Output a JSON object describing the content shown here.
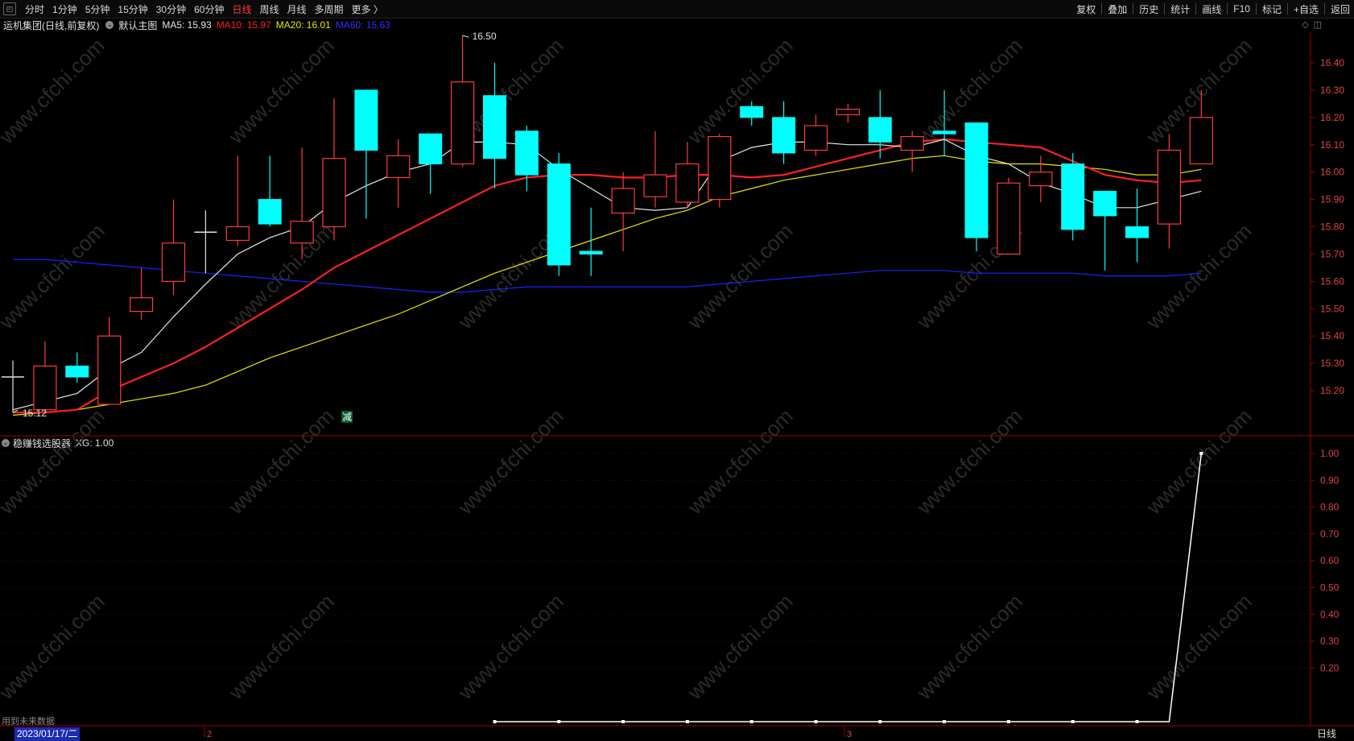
{
  "toolbar": {
    "periods": [
      "分时",
      "1分钟",
      "5分钟",
      "15分钟",
      "30分钟",
      "60分钟",
      "日线",
      "周线",
      "月线",
      "多周期",
      "更多 〉"
    ],
    "active_period": "日线",
    "right_items": [
      "复权",
      "叠加",
      "历史",
      "统计",
      "画线",
      "F10",
      "标记",
      "+自选",
      "返回"
    ]
  },
  "info": {
    "stock_name": "运机集团(日线,前复权)",
    "template": "默认主图",
    "ma5": "MA5: 15.93",
    "ma10": "MA10: 15.97",
    "ma20": "MA20: 16.01",
    "ma60": "MA60: 15.63"
  },
  "indicator": {
    "name": "稳赚钱选股器",
    "value_text": "XG: 1.00",
    "future_note": "用到未来数据"
  },
  "footer": {
    "date": "2023/01/17/二",
    "period": "日线",
    "month_labels": [
      "2",
      "3"
    ]
  },
  "colors": {
    "up": "#ff3b3b",
    "down": "#00ffff",
    "ma5": "#e6e6e6",
    "ma10": "#ff2020",
    "ma20": "#e8e800",
    "ma60": "#2020ff",
    "axis": "#a00000",
    "watermark": "#2a2a2a"
  },
  "watermark": "www.cfchi.com",
  "annotations": {
    "high": "16.50",
    "low": "15.12",
    "signal": "减"
  },
  "chart_data": [
    {
      "type": "candlestick",
      "title": "",
      "y_ticks": [
        "16.40",
        "16.30",
        "16.20",
        "16.10",
        "16.00",
        "15.90",
        "15.80",
        "15.70",
        "15.60",
        "15.50",
        "15.40",
        "15.30",
        "15.20"
      ],
      "ylim": [
        15.0,
        16.55
      ],
      "candles": [
        {
          "o": 15.25,
          "c": 15.25,
          "h": 15.31,
          "l": 15.12
        },
        {
          "o": 15.13,
          "c": 15.29,
          "h": 15.38,
          "l": 15.12
        },
        {
          "o": 15.29,
          "c": 15.25,
          "h": 15.34,
          "l": 15.23
        },
        {
          "o": 15.15,
          "c": 15.4,
          "h": 15.47,
          "l": 15.15
        },
        {
          "o": 15.49,
          "c": 15.54,
          "h": 15.65,
          "l": 15.46
        },
        {
          "o": 15.6,
          "c": 15.74,
          "h": 15.9,
          "l": 15.55
        },
        {
          "o": 15.78,
          "c": 15.78,
          "h": 15.86,
          "l": 15.63
        },
        {
          "o": 15.75,
          "c": 15.8,
          "h": 16.06,
          "l": 15.73
        },
        {
          "o": 15.9,
          "c": 15.81,
          "h": 16.06,
          "l": 15.8
        },
        {
          "o": 15.74,
          "c": 15.82,
          "h": 16.09,
          "l": 15.68
        },
        {
          "o": 15.8,
          "c": 16.05,
          "h": 16.27,
          "l": 15.75
        },
        {
          "o": 16.3,
          "c": 16.08,
          "h": 16.3,
          "l": 15.83
        },
        {
          "o": 15.98,
          "c": 16.06,
          "h": 16.12,
          "l": 15.87
        },
        {
          "o": 16.14,
          "c": 16.03,
          "h": 16.14,
          "l": 15.92
        },
        {
          "o": 16.03,
          "c": 16.33,
          "h": 16.5,
          "l": 16.02
        },
        {
          "o": 16.28,
          "c": 16.05,
          "h": 16.4,
          "l": 15.94
        },
        {
          "o": 16.15,
          "c": 15.99,
          "h": 16.17,
          "l": 15.93
        },
        {
          "o": 16.03,
          "c": 15.66,
          "h": 16.07,
          "l": 15.62
        },
        {
          "o": 15.71,
          "c": 15.7,
          "h": 15.87,
          "l": 15.62
        },
        {
          "o": 15.85,
          "c": 15.94,
          "h": 16.0,
          "l": 15.71
        },
        {
          "o": 15.91,
          "c": 15.99,
          "h": 16.15,
          "l": 15.87
        },
        {
          "o": 15.89,
          "c": 16.03,
          "h": 16.11,
          "l": 15.87
        },
        {
          "o": 15.9,
          "c": 16.13,
          "h": 16.14,
          "l": 15.87
        },
        {
          "o": 16.24,
          "c": 16.2,
          "h": 16.26,
          "l": 16.17
        },
        {
          "o": 16.2,
          "c": 16.07,
          "h": 16.26,
          "l": 16.03
        },
        {
          "o": 16.08,
          "c": 16.17,
          "h": 16.21,
          "l": 16.06
        },
        {
          "o": 16.21,
          "c": 16.23,
          "h": 16.25,
          "l": 16.18
        },
        {
          "o": 16.2,
          "c": 16.11,
          "h": 16.3,
          "l": 16.05
        },
        {
          "o": 16.08,
          "c": 16.13,
          "h": 16.15,
          "l": 16.0
        },
        {
          "o": 16.15,
          "c": 16.14,
          "h": 16.3,
          "l": 16.06
        },
        {
          "o": 16.18,
          "c": 15.76,
          "h": 16.18,
          "l": 15.71
        },
        {
          "o": 15.7,
          "c": 15.96,
          "h": 15.98,
          "l": 15.7
        },
        {
          "o": 15.95,
          "c": 16.0,
          "h": 16.06,
          "l": 15.89
        },
        {
          "o": 16.03,
          "c": 15.79,
          "h": 16.07,
          "l": 15.75
        },
        {
          "o": 15.93,
          "c": 15.84,
          "h": 15.93,
          "l": 15.64
        },
        {
          "o": 15.8,
          "c": 15.76,
          "h": 15.94,
          "l": 15.67
        },
        {
          "o": 15.81,
          "c": 16.08,
          "h": 16.14,
          "l": 15.72
        },
        {
          "o": 16.03,
          "c": 16.2,
          "h": 16.3,
          "l": 16.03
        }
      ],
      "ma5": [
        15.13,
        15.16,
        15.19,
        15.28,
        15.34,
        15.47,
        15.59,
        15.7,
        15.76,
        15.8,
        15.89,
        15.95,
        16.0,
        16.03,
        16.11,
        16.11,
        16.1,
        16.01,
        15.94,
        15.87,
        15.86,
        15.87,
        16.04,
        16.09,
        16.11,
        16.11,
        16.1,
        16.1,
        16.09,
        16.12,
        16.06,
        16.03,
        15.96,
        15.92,
        15.87,
        15.87,
        15.9,
        15.93
      ],
      "ma10": [
        15.12,
        15.12,
        15.13,
        15.2,
        15.25,
        15.3,
        15.36,
        15.43,
        15.5,
        15.57,
        15.65,
        15.71,
        15.77,
        15.83,
        15.89,
        15.95,
        15.98,
        15.99,
        15.99,
        15.98,
        15.98,
        15.99,
        15.99,
        15.98,
        15.99,
        16.02,
        16.05,
        16.08,
        16.11,
        16.12,
        16.11,
        16.1,
        16.09,
        16.04,
        15.99,
        15.97,
        15.96,
        15.97
      ],
      "ma20": [
        15.11,
        15.12,
        15.13,
        15.15,
        15.17,
        15.19,
        15.22,
        15.27,
        15.32,
        15.36,
        15.4,
        15.44,
        15.48,
        15.53,
        15.58,
        15.63,
        15.67,
        15.71,
        15.75,
        15.79,
        15.83,
        15.86,
        15.91,
        15.94,
        15.97,
        15.99,
        16.01,
        16.03,
        16.05,
        16.06,
        16.04,
        16.03,
        16.03,
        16.02,
        16.01,
        15.99,
        15.99,
        16.01
      ],
      "ma60": [
        15.68,
        15.68,
        15.67,
        15.66,
        15.65,
        15.64,
        15.63,
        15.62,
        15.61,
        15.6,
        15.59,
        15.58,
        15.57,
        15.56,
        15.56,
        15.57,
        15.58,
        15.58,
        15.58,
        15.58,
        15.58,
        15.58,
        15.59,
        15.6,
        15.61,
        15.62,
        15.63,
        15.64,
        15.64,
        15.64,
        15.63,
        15.63,
        15.63,
        15.63,
        15.62,
        15.62,
        15.62,
        15.63
      ]
    },
    {
      "type": "line",
      "title": "",
      "series": [
        {
          "name": "XG",
          "values": [
            0,
            0,
            0,
            0,
            0,
            0,
            0,
            0,
            0,
            0,
            0,
            0,
            0,
            0,
            0,
            0,
            0,
            0,
            0,
            0,
            0,
            0,
            0,
            0,
            0,
            0,
            0,
            0,
            0,
            0,
            0,
            0,
            0,
            0,
            0,
            0,
            0,
            1
          ]
        }
      ],
      "y_ticks": [
        "1.00",
        "0.90",
        "0.80",
        "0.70",
        "0.60",
        "0.50",
        "0.40",
        "0.30",
        "0.20"
      ],
      "ylim": [
        0,
        1.0
      ]
    }
  ]
}
